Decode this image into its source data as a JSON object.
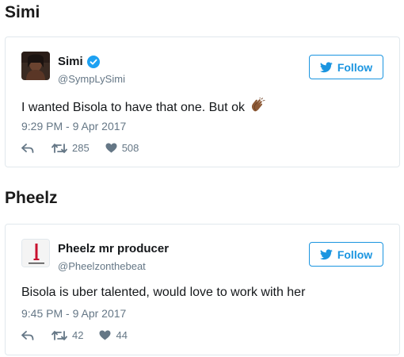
{
  "sections": [
    {
      "heading": "Simi",
      "tweet": {
        "name": "Simi",
        "verified": true,
        "handle": "@SympLySimi",
        "text": "I wanted Bisola to have that one. But ok",
        "emoji": "clapping-hands-icon",
        "timestamp": "9:29 PM - 9 Apr 2017",
        "retweets": "285",
        "likes": "508",
        "follow_label": "Follow"
      }
    },
    {
      "heading": "Pheelz",
      "tweet": {
        "name": "Pheelz mr producer",
        "verified": false,
        "handle": "@Pheelzonthebeat",
        "text": "Bisola is uber talented, would love to work with her",
        "timestamp": "9:45 PM - 9 Apr 2017",
        "retweets": "42",
        "likes": "44",
        "follow_label": "Follow"
      }
    }
  ],
  "colors": {
    "twitter_blue": "#1b95e0",
    "muted_gray": "#657786",
    "border": "#e1e8ed",
    "text": "#14171a"
  }
}
